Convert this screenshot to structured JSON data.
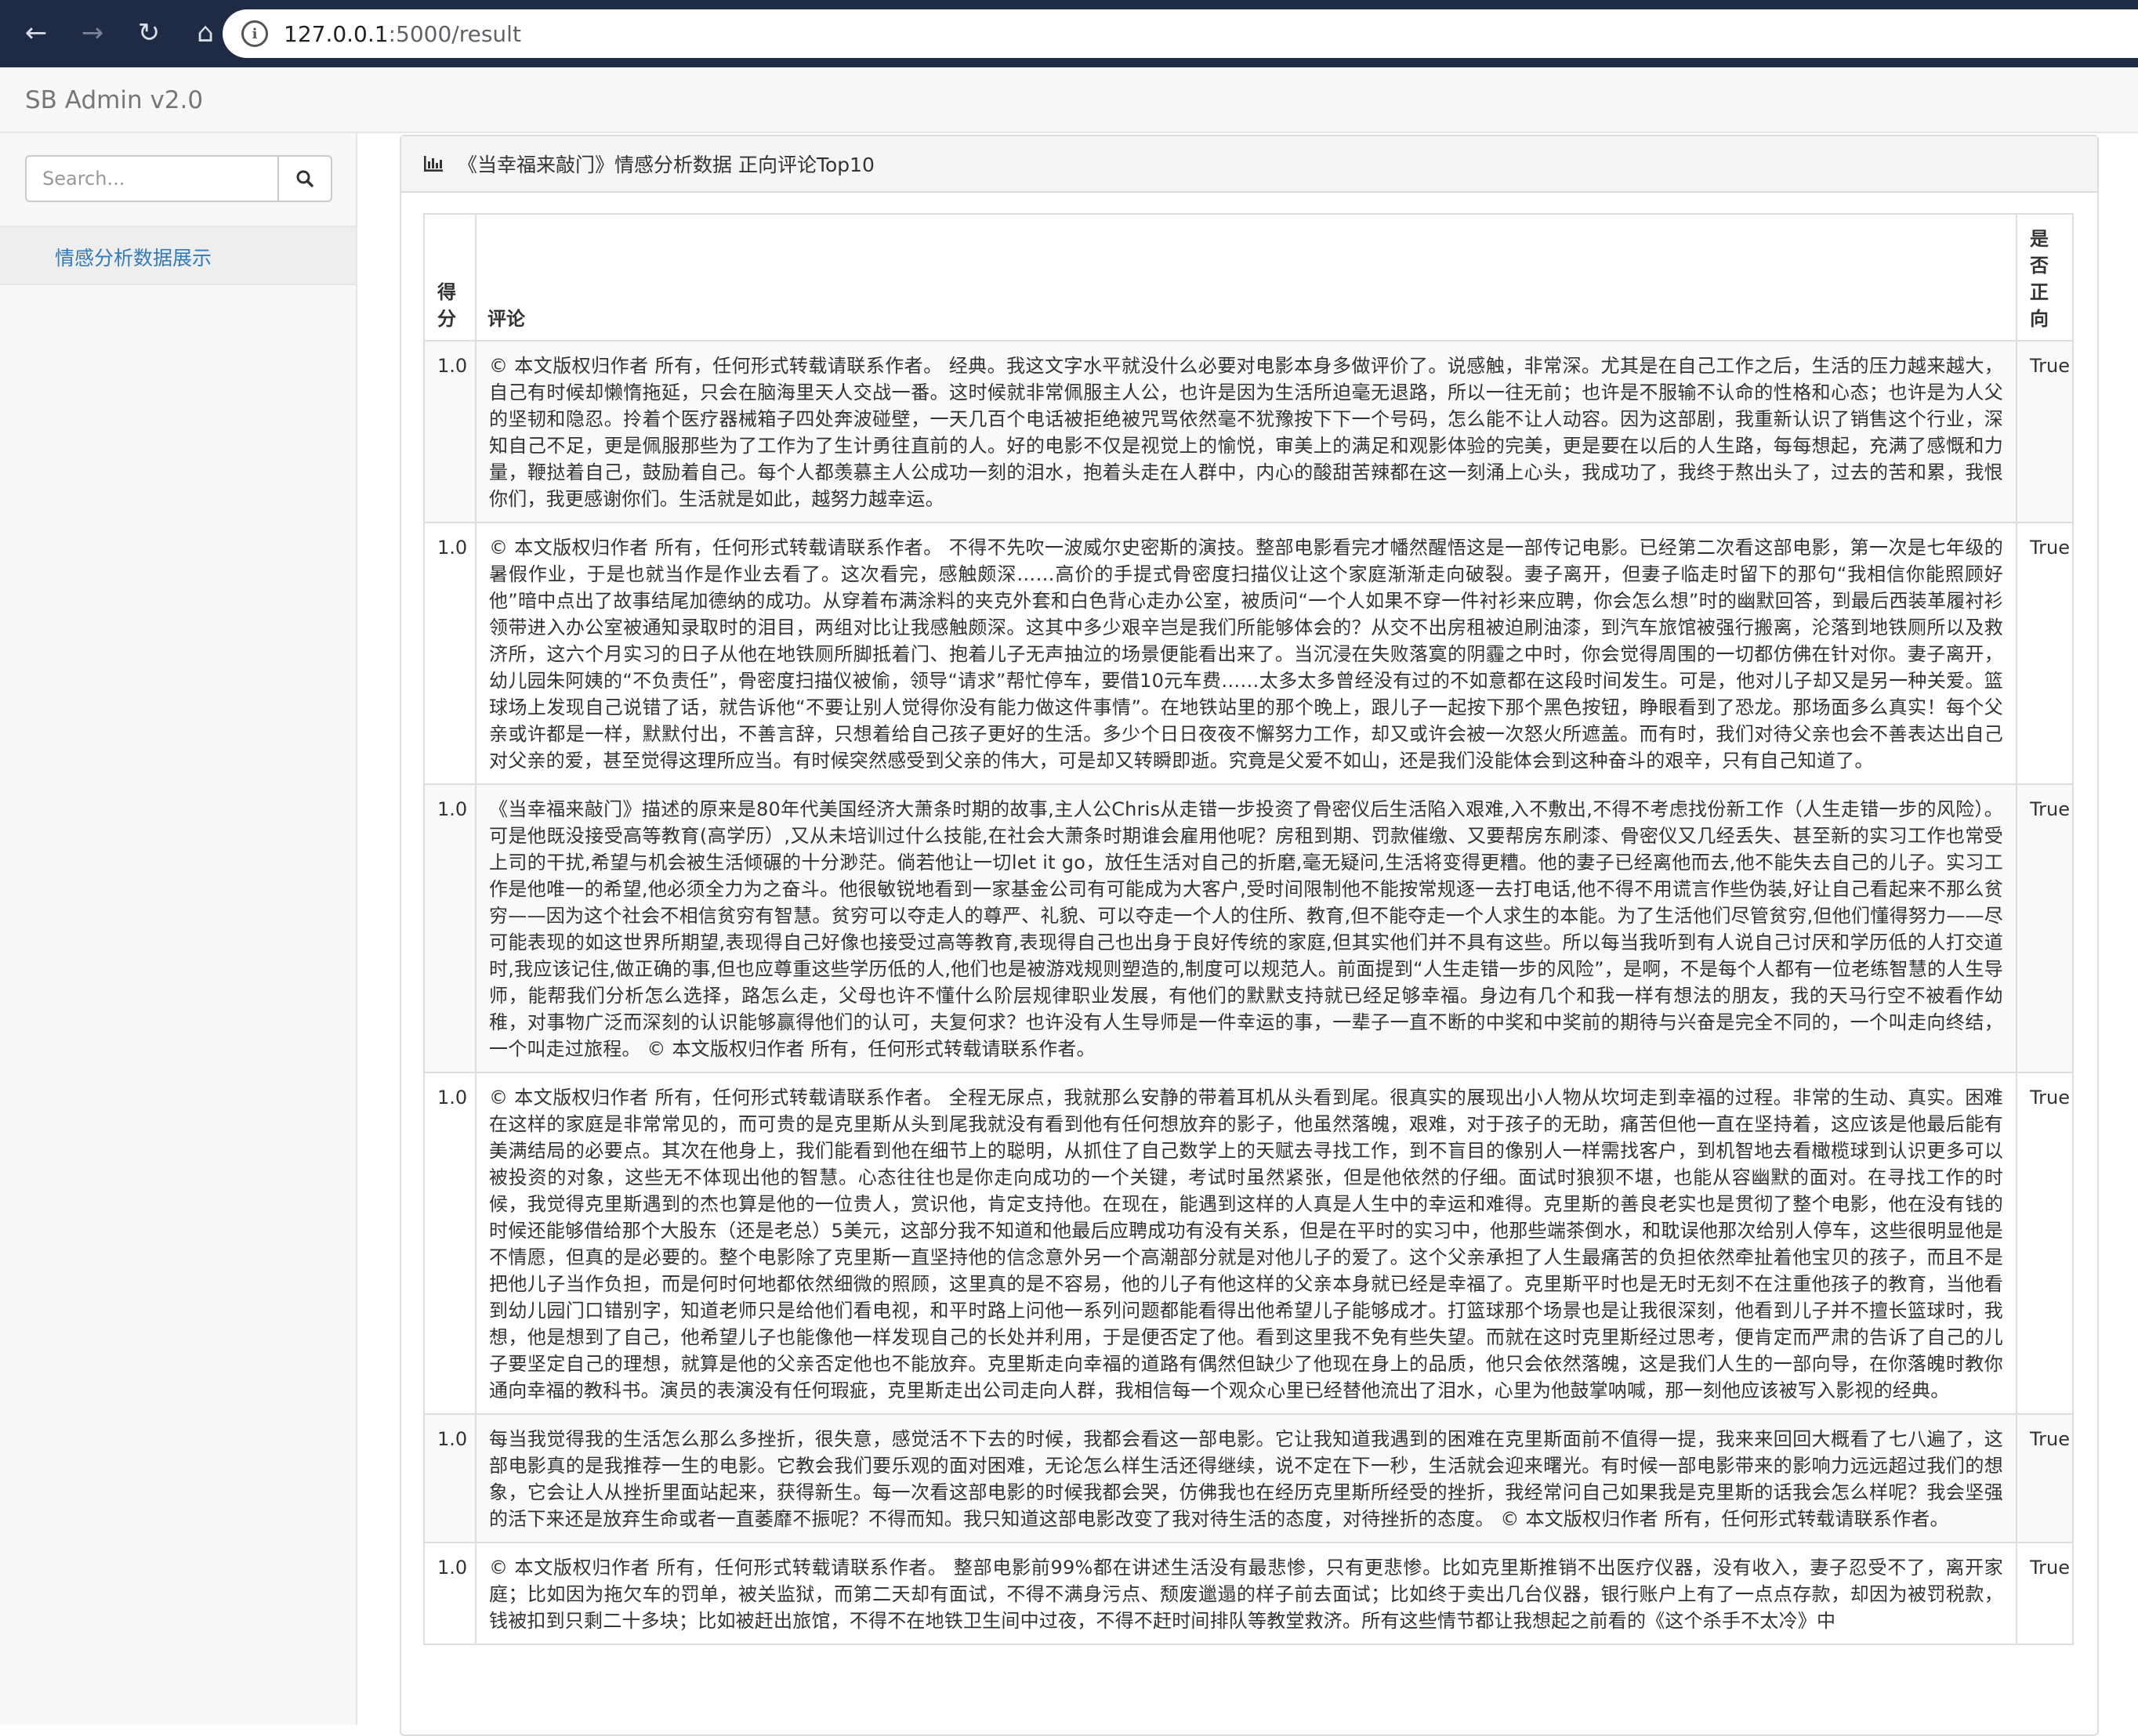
{
  "browser": {
    "url_host": "127.0.0.1",
    "url_path": ":5000/result"
  },
  "navbar": {
    "brand": "SB Admin v2.0"
  },
  "sidebar": {
    "search_placeholder": "Search...",
    "items": [
      {
        "label": "情感分析数据展示"
      }
    ]
  },
  "panel": {
    "title": "《当幸福来敲门》情感分析数据 正向评论Top10",
    "table": {
      "headers": {
        "score": "得分",
        "comment": "评论",
        "positive": "是否正向"
      },
      "rows": [
        {
          "score": "1.0",
          "comment": "© 本文版权归作者  所有，任何形式转载请联系作者。 经典。我这文字水平就没什么必要对电影本身多做评价了。说感触，非常深。尤其是在自己工作之后，生活的压力越来越大，自己有时候却懒惰拖延，只会在脑海里天人交战一番。这时候就非常佩服主人公，也许是因为生活所迫毫无退路，所以一往无前；也许是不服输不认命的性格和心态；也许是为人父的坚韧和隐忍。拎着个医疗器械箱子四处奔波碰壁，一天几百个电话被拒绝被咒骂依然毫不犹豫按下下一个号码，怎么能不让人动容。因为这部剧，我重新认识了销售这个行业，深知自己不足，更是佩服那些为了工作为了生计勇往直前的人。好的电影不仅是视觉上的愉悦，审美上的满足和观影体验的完美，更是要在以后的人生路，每每想起，充满了感慨和力量，鞭挞着自己，鼓励着自己。每个人都羡慕主人公成功一刻的泪水，抱着头走在人群中，内心的酸甜苦辣都在这一刻涌上心头，我成功了，我终于熬出头了，过去的苦和累，我恨你们，我更感谢你们。生活就是如此，越努力越幸运。",
          "positive": "True"
        },
        {
          "score": "1.0",
          "comment": "© 本文版权归作者  所有，任何形式转载请联系作者。 不得不先吹一波威尔史密斯的演技。整部电影看完才幡然醒悟这是一部传记电影。已经第二次看这部电影，第一次是七年级的暑假作业，于是也就当作是作业去看了。这次看完，感触颇深……高价的手提式骨密度扫描仪让这个家庭渐渐走向破裂。妻子离开，但妻子临走时留下的那句“我相信你能照顾好他”暗中点出了故事结尾加德纳的成功。从穿着布满涂料的夹克外套和白色背心走办公室，被质问“一个人如果不穿一件衬衫来应聘，你会怎么想”时的幽默回答，到最后西装革履衬衫领带进入办公室被通知录取时的泪目，两组对比让我感触颇深。这其中多少艰辛岂是我们所能够体会的？从交不出房租被迫刷油漆，到汽车旅馆被强行搬离，沦落到地铁厕所以及救济所，这六个月实习的日子从他在地铁厕所脚抵着门、抱着儿子无声抽泣的场景便能看出来了。当沉浸在失败落寞的阴霾之中时，你会觉得周围的一切都仿佛在针对你。妻子离开，幼儿园朱阿姨的“不负责任”，骨密度扫描仪被偷，领导“请求”帮忙停车，要借10元车费……太多太多曾经没有过的不如意都在这段时间发生。可是，他对儿子却又是另一种关爱。篮球场上发现自己说错了话，就告诉他“不要让别人觉得你没有能力做这件事情”。在地铁站里的那个晚上，跟儿子一起按下那个黑色按钮，睁眼看到了恐龙。那场面多么真实！每个父亲或许都是一样，默默付出，不善言辞，只想着给自己孩子更好的生活。多少个日日夜夜不懈努力工作，却又或许会被一次怒火所遮盖。而有时，我们对待父亲也会不善表达出自己对父亲的爱，甚至觉得这理所应当。有时候突然感受到父亲的伟大，可是却又转瞬即逝。究竟是父爱不如山，还是我们没能体会到这种奋斗的艰辛，只有自己知道了。",
          "positive": "True"
        },
        {
          "score": "1.0",
          "comment": "《当幸福来敲门》描述的原来是80年代美国经济大萧条时期的故事,主人公Chris从走错一步投资了骨密仪后生活陷入艰难,入不敷出,不得不考虑找份新工作（人生走错一步的风险）。可是他既没接受高等教育(高学历）,又从未培训过什么技能,在社会大萧条时期谁会雇用他呢？房租到期、罚款催缴、又要帮房东刷漆、骨密仪又几经丢失、甚至新的实习工作也常受上司的干扰,希望与机会被生活倾碾的十分渺茫。倘若他让一切let it go，放任生活对自己的折磨,毫无疑问,生活将变得更糟。他的妻子已经离他而去,他不能失去自己的儿子。实习工作是他唯一的希望,他必须全力为之奋斗。他很敏锐地看到一家基金公司有可能成为大客户,受时间限制他不能按常规逐一去打电话,他不得不用谎言作些伪装,好让自己看起来不那么贫穷——因为这个社会不相信贫穷有智慧。贫穷可以夺走人的尊严、礼貌、可以夺走一个人的住所、教育,但不能夺走一个人求生的本能。为了生活他们尽管贫穷,但他们懂得努力——尽可能表现的如这世界所期望,表现得自己好像也接受过高等教育,表现得自己也出身于良好传统的家庭,但其实他们并不具有这些。所以每当我听到有人说自己讨厌和学历低的人打交道时,我应该记住,做正确的事,但也应尊重这些学历低的人,他们也是被游戏规则塑造的,制度可以规范人。前面提到“人生走错一步的风险”，是啊，不是每个人都有一位老练智慧的人生导师，能帮我们分析怎么选择，路怎么走，父母也许不懂什么阶层规律职业发展，有他们的默默支持就已经足够幸福。身边有几个和我一样有想法的朋友，我的天马行空不被看作幼稚，对事物广泛而深刻的认识能够赢得他们的认可，夫复何求？也许没有人生导师是一件幸运的事，一辈子一直不断的中奖和中奖前的期待与兴奋是完全不同的，一个叫走向终结，一个叫走过旅程。 © 本文版权归作者  所有，任何形式转载请联系作者。",
          "positive": "True"
        },
        {
          "score": "1.0",
          "comment": "© 本文版权归作者  所有，任何形式转载请联系作者。 全程无尿点，我就那么安静的带着耳机从头看到尾。很真实的展现出小人物从坎坷走到幸福的过程。非常的生动、真实。困难在这样的家庭是非常常见的，而可贵的是克里斯从头到尾我就没有看到他有任何想放弃的影子，他虽然落魄，艰难，对于孩子的无助，痛苦但他一直在坚持着，这应该是他最后能有美满结局的必要点。其次在他身上，我们能看到他在细节上的聪明，从抓住了自己数学上的天赋去寻找工作，到不盲目的像别人一样需找客户，到机智地去看橄榄球到认识更多可以被投资的对象，这些无不体现出他的智慧。心态往往也是你走向成功的一个关键，考试时虽然紧张，但是他依然的仔细。面试时狼狈不堪，也能从容幽默的面对。在寻找工作的时候，我觉得克里斯遇到的杰也算是他的一位贵人，赏识他，肯定支持他。在现在，能遇到这样的人真是人生中的幸运和难得。克里斯的善良老实也是贯彻了整个电影，他在没有钱的时候还能够借给那个大股东（还是老总）5美元，这部分我不知道和他最后应聘成功有没有关系，但是在平时的实习中，他那些端茶倒水，和耽误他那次给别人停车，这些很明显他是不情愿，但真的是必要的。整个电影除了克里斯一直坚持他的信念意外另一个高潮部分就是对他儿子的爱了。这个父亲承担了人生最痛苦的负担依然牵扯着他宝贝的孩子，而且不是把他儿子当作负担，而是何时何地都依然细微的照顾，这里真的是不容易，他的儿子有他这样的父亲本身就已经是幸福了。克里斯平时也是无时无刻不在注重他孩子的教育，当他看到幼儿园门口错别字，知道老师只是给他们看电视，和平时路上问他一系列问题都能看得出他希望儿子能够成才。打篮球那个场景也是让我很深刻，他看到儿子并不擅长篮球时，我想，他是想到了自己，他希望儿子也能像他一样发现自己的长处并利用，于是便否定了他。看到这里我不免有些失望。而就在这时克里斯经过思考，便肯定而严肃的告诉了自己的儿子要坚定自己的理想，就算是他的父亲否定他也不能放弃。克里斯走向幸福的道路有偶然但缺少了他现在身上的品质，他只会依然落魄，这是我们人生的一部向导，在你落魄时教你通向幸福的教科书。演员的表演没有任何瑕疵，克里斯走出公司走向人群，我相信每一个观众心里已经替他流出了泪水，心里为他鼓掌呐喊，那一刻他应该被写入影视的经典。",
          "positive": "True"
        },
        {
          "score": "1.0",
          "comment": "每当我觉得我的生活怎么那么多挫折，很失意，感觉活不下去的时候，我都会看这一部电影。它让我知道我遇到的困难在克里斯面前不值得一提，我来来回回大概看了七八遍了，这部电影真的是我推荐一生的电影。它教会我们要乐观的面对困难，无论怎么样生活还得继续，说不定在下一秒，生活就会迎来曙光。有时候一部电影带来的影响力远远超过我们的想象，它会让人从挫折里面站起来，获得新生。每一次看这部电影的时候我都会哭，仿佛我也在经历克里斯所经受的挫折，我经常问自己如果我是克里斯的话我会怎么样呢？我会坚强的活下来还是放弃生命或者一直萎靡不振呢？不得而知。我只知道这部电影改变了我对待生活的态度，对待挫折的态度。 © 本文版权归作者  所有，任何形式转载请联系作者。",
          "positive": "True"
        },
        {
          "score": "1.0",
          "comment": "© 本文版权归作者  所有，任何形式转载请联系作者。 整部电影前99%都在讲述生活没有最悲惨，只有更悲惨。比如克里斯推销不出医疗仪器，没有收入，妻子忍受不了，离开家庭；比如因为拖欠车的罚单，被关监狱，而第二天却有面试，不得不满身污点、颓废邋遢的样子前去面试；比如终于卖出几台仪器，银行账户上有了一点点存款，却因为被罚税款，钱被扣到只剩二十多块；比如被赶出旅馆，不得不在地铁卫生间中过夜，不得不赶时间排队等教堂救济。所有这些情节都让我想起之前看的《这个杀手不太冷》中",
          "positive": "True"
        }
      ]
    }
  }
}
